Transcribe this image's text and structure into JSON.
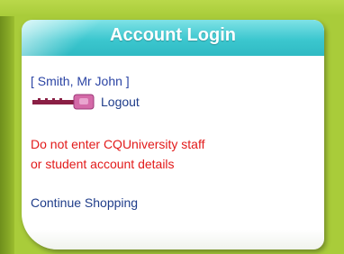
{
  "login_panel": {
    "title": "Account Login",
    "user_name": "[ Smith, Mr John ]",
    "logout_label": "Logout",
    "warning_line1": "Do not enter CQUniversity staff",
    "warning_line2": "or student account details",
    "continue_label": "Continue Shopping"
  },
  "icons": {
    "key": "key-icon"
  },
  "colors": {
    "background": "#a9cc3a",
    "header": "#3cc7cf",
    "link": "#1f3d8a",
    "warning": "#e21a1a"
  }
}
